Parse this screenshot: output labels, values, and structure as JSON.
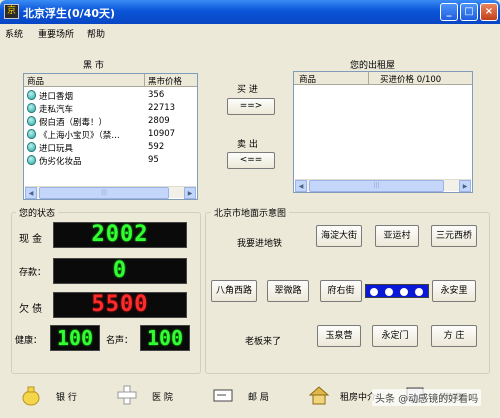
{
  "window": {
    "title": "北京浮生(0/40天)"
  },
  "menu": {
    "items": [
      "系统",
      "重要场所",
      "帮助"
    ]
  },
  "black_market": {
    "title": "黑    市",
    "col_goods": "商品",
    "col_price": "黑市价格",
    "rows": [
      {
        "name": "进口香烟",
        "price": "356"
      },
      {
        "name": "走私汽车",
        "price": "22713"
      },
      {
        "name": "假白酒（剧毒！）",
        "price": "2809"
      },
      {
        "name": "《上海小宝贝》（禁…",
        "price": "10907"
      },
      {
        "name": "进口玩具",
        "price": "592"
      },
      {
        "name": "伪劣化妆品",
        "price": "95"
      }
    ]
  },
  "trade": {
    "buy_label": "买    进",
    "buy_button": "==>",
    "sell_label": "卖    出",
    "sell_button": "<=="
  },
  "rental": {
    "title": "您的出租屋",
    "col_goods": "商品",
    "col_price": "买进价格 0/100"
  },
  "status": {
    "title": "您的状态",
    "cash_label": "现  金",
    "cash_value": "2002",
    "deposit_label": "存款：",
    "deposit_value": "0",
    "debt_label": "欠  债",
    "debt_value": "5500",
    "health_label": "健康：",
    "health_value": "100",
    "fame_label": "名声：",
    "fame_value": "100"
  },
  "map": {
    "title": "北京市地面示意图",
    "subway_label": "我要进地铁",
    "boss_label": "老板来了",
    "stations": [
      "海淀大街",
      "亚运村",
      "三元西桥",
      "八角西路",
      "翠微路",
      "府右街",
      "永安里",
      "玉泉营",
      "永定门",
      "方  庄"
    ],
    "dot_count": 4
  },
  "bottom": {
    "bank": "银    行",
    "hospital": "医    院",
    "post": "邮    局",
    "rent": "租房中介",
    "net": "网    吧"
  },
  "watermark": "头条 @动感镜的好看吗",
  "colors": {
    "led_green": "#32ff32",
    "led_red": "#ff2a2a",
    "title_blue": "#0a55d8",
    "dots_blue": "#0a18d8"
  }
}
